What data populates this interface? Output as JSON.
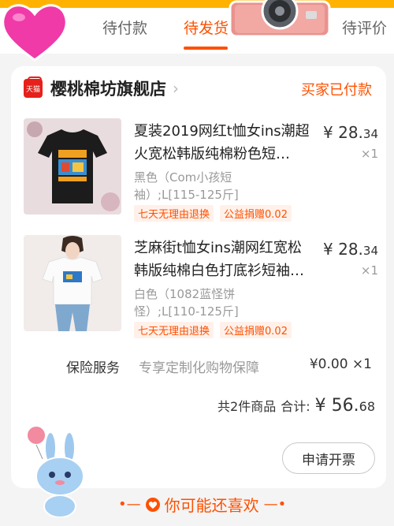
{
  "tabs": [
    {
      "label": "待付款"
    },
    {
      "label": "待发货"
    },
    {
      "label": "待评价"
    }
  ],
  "store": {
    "badge": "天猫",
    "name": "樱桃棉坊旗舰店",
    "chevron": "›",
    "status": "买家已付款"
  },
  "items": [
    {
      "title": "夏装2019网红t恤女ins潮超火宽松韩版纯棉粉色短…",
      "spec": "黑色（Com小孩短袖）;L[115-125斤]",
      "price_symbol": "¥",
      "price_int": "28.",
      "price_cents": "34",
      "qty": "×1",
      "tags": [
        "七天无理由退换",
        "公益捐赠0.02"
      ]
    },
    {
      "title": "芝麻街t恤女ins潮网红宽松韩版纯棉白色打底衫短袖…",
      "spec": "白色（1082蓝怪饼怪）;L[110-125斤]",
      "price_symbol": "¥",
      "price_int": "28.",
      "price_cents": "34",
      "qty": "×1",
      "tags": [
        "七天无理由退换",
        "公益捐赠0.02"
      ]
    }
  ],
  "insurance": {
    "label": "保险服务",
    "desc": "专享定制化购物保障",
    "price": "¥0.00 ×1"
  },
  "summary": {
    "count_text": "共2件商品",
    "total_label": "合计:",
    "symbol": "¥",
    "total_int": "56.",
    "total_cents": "68"
  },
  "buttons": {
    "invoice": "申请开票"
  },
  "recommend": {
    "left": "•—",
    "label": "你可能还喜欢",
    "right": "—•"
  },
  "colors": {
    "accent": "#ff5000",
    "tmall_red": "#e6201a"
  }
}
